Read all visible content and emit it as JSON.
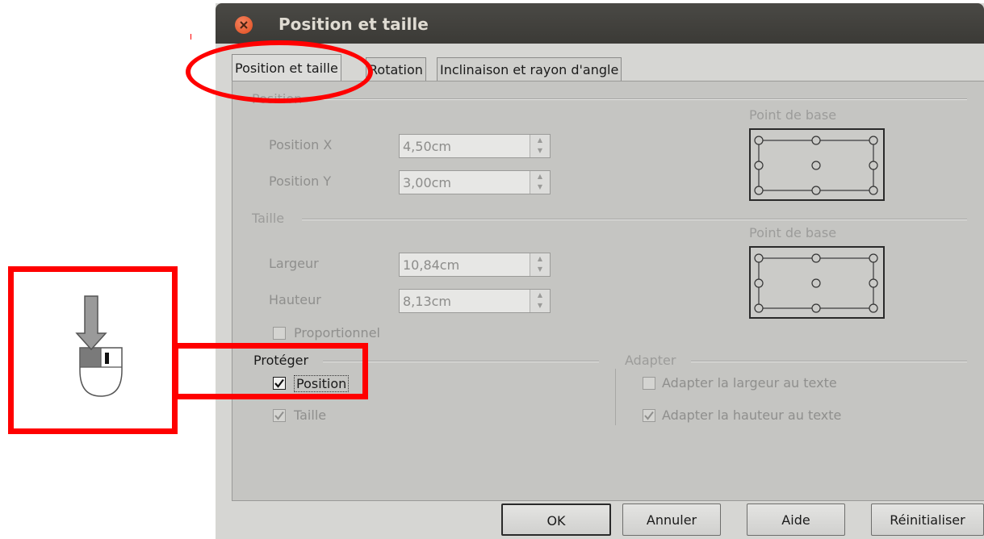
{
  "dialog": {
    "title": "Position et taille",
    "tabs": [
      {
        "label": "Position et taille",
        "active": true
      },
      {
        "label": "Rotation",
        "active": false
      },
      {
        "label": "Inclinaison et rayon d'angle",
        "active": false
      }
    ]
  },
  "position": {
    "group_label": "Position",
    "x_label": "Position X",
    "x_value": "4,50cm",
    "y_label": "Position Y",
    "y_value": "3,00cm",
    "base_point_label": "Point de base"
  },
  "size": {
    "group_label": "Taille",
    "width_label": "Largeur",
    "width_value": "10,84cm",
    "height_label": "Hauteur",
    "height_value": "8,13cm",
    "base_point_label": "Point de base",
    "proportional_label": "Proportionnel",
    "proportional_checked": false
  },
  "protect": {
    "group_label": "Protéger",
    "position_label": "Position",
    "position_checked": true,
    "size_label": "Taille",
    "size_checked": true
  },
  "adapt": {
    "group_label": "Adapter",
    "fit_width_label": "Adapter la largeur au texte",
    "fit_width_checked": false,
    "fit_height_label": "Adapter la hauteur au texte",
    "fit_height_checked": true
  },
  "buttons": {
    "ok": "OK",
    "cancel": "Annuler",
    "help": "Aide",
    "reset": "Réinitialiser"
  },
  "colors": {
    "highlight": "#ff0000",
    "title_bar": "#3c3b37",
    "dialog_bg": "#d6d6d3"
  },
  "icons": {
    "mouse_click": "mouse-left-click-icon",
    "close": "close-icon"
  }
}
